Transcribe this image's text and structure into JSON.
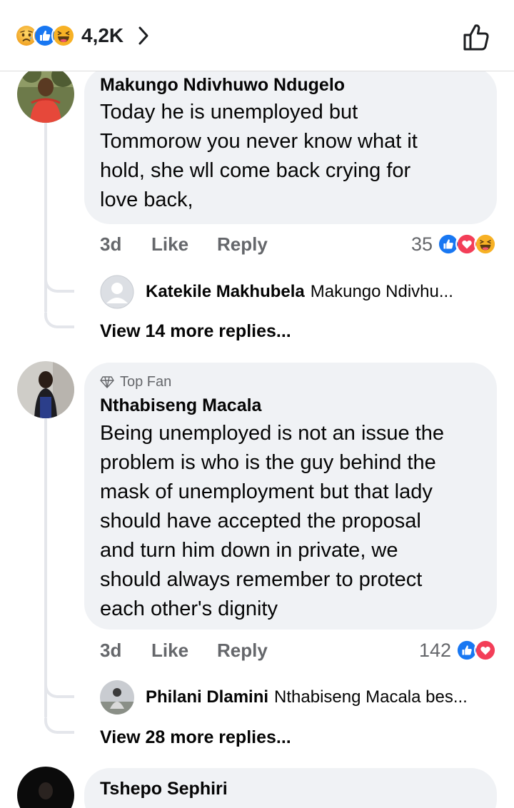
{
  "header": {
    "reactions": [
      "sad",
      "like",
      "haha"
    ],
    "total_reactions": "4,2K",
    "icons": {
      "chevron": "chevron-right-icon",
      "like_post": "thumbs-up-outline-icon"
    }
  },
  "comments": [
    {
      "author": "Makungo Ndivhuwo Ndugelo",
      "lines": [
        "Today he is unemployed but",
        "Tommorow you never know what it",
        "hold, she wll come back crying for",
        "love back,"
      ],
      "time": "3d",
      "like_label": "Like",
      "reply_label": "Reply",
      "reaction_count": "35",
      "reactions": [
        "like",
        "love",
        "haha"
      ],
      "reply_preview": {
        "author": "Katekile Makhubela",
        "text": "Makungo Ndivhu..."
      },
      "view_more": "View 14 more replies..."
    },
    {
      "badge": "Top Fan",
      "author": "Nthabiseng Macala",
      "lines": [
        "Being unemployed is not an issue the",
        "problem is who is the guy behind the",
        "mask of unemployment but that lady",
        "should have accepted the proposal",
        "and turn him down in private, we",
        "should always remember to protect",
        "each other's dignity"
      ],
      "time": "3d",
      "like_label": "Like",
      "reply_label": "Reply",
      "reaction_count": "142",
      "reactions": [
        "like",
        "love"
      ],
      "reply_preview": {
        "author": "Philani Dlamini",
        "text": "Nthabiseng Macala bes..."
      },
      "view_more": "View 28 more replies..."
    },
    {
      "author": "Tshepo Sephiri"
    }
  ],
  "colors": {
    "like_blue": "#1877f2",
    "love_red": "#f33e58",
    "haha_yellow": "#f7b125",
    "bubble_bg": "#f0f2f5",
    "meta_gray": "#65676b"
  }
}
